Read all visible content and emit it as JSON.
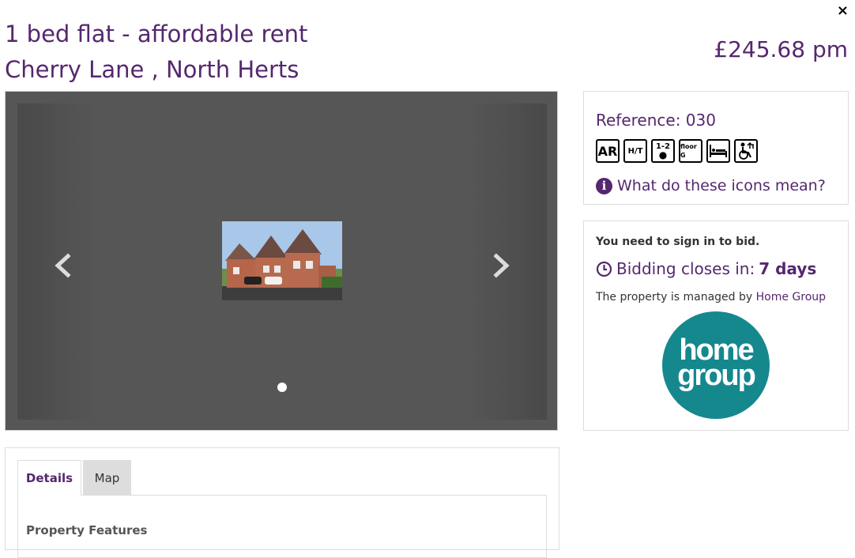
{
  "modal": {
    "close_label": "×"
  },
  "property": {
    "title": "1 bed flat - affordable rent",
    "location": "Cherry Lane , North Herts",
    "price": "£245.68 pm"
  },
  "carousel": {
    "prev_label": "Previous",
    "next_label": "Next",
    "slide_count": 1,
    "active_slide": 1
  },
  "reference_panel": {
    "reference": "Reference: 030",
    "icons": [
      "AR",
      "H/T",
      "1-2",
      "floor G",
      "bed",
      "accessible"
    ],
    "icons_help": "What do these icons mean?"
  },
  "bid_panel": {
    "signin_text": "You need to sign in to bid.",
    "bidding_prefix": "Bidding closes in:",
    "bidding_value": "7 days",
    "managed_prefix": "The property is managed by",
    "managed_by": "Home Group",
    "logo_line1": "home",
    "logo_line2": "group"
  },
  "tabs": {
    "details": "Details",
    "map": "Map",
    "active": "Details"
  },
  "details": {
    "features_heading": "Property Features"
  },
  "colors": {
    "brand": "#55276f",
    "logo": "#15888e",
    "carousel_bg": "#565656"
  }
}
